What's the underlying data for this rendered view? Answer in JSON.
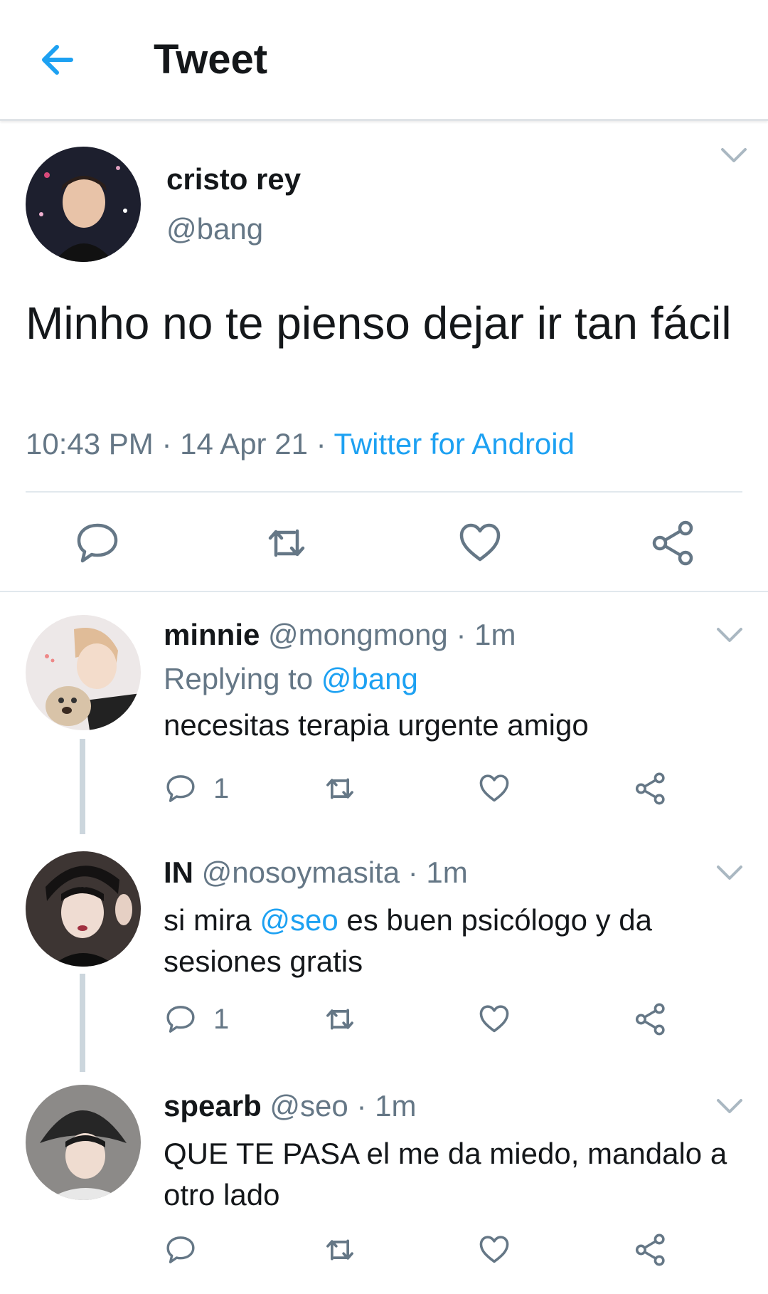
{
  "header": {
    "title": "Tweet"
  },
  "main_tweet": {
    "name": "cristo rey",
    "handle": "@bang",
    "text": "Minho no te pienso dejar ir tan fácil",
    "time": "10:43 PM",
    "sep1": " · ",
    "date": "14 Apr 21",
    "sep2": " · ",
    "source": "Twitter for Android"
  },
  "replies": [
    {
      "name": "minnie",
      "handle": "@mongmong",
      "time": "· 1m",
      "replying_prefix": "Replying to ",
      "replying_to": "@bang",
      "text": "necesitas terapia urgente amigo",
      "reply_count": "1"
    },
    {
      "name": "IN",
      "handle": "@nosoymasita",
      "time": "· 1m",
      "text_before": "si mira ",
      "mention": "@seo",
      "text_after": " es buen psicólogo y da sesiones gratis",
      "reply_count": "1"
    },
    {
      "name": "spearb",
      "handle": "@seo",
      "time": "· 1m",
      "text": "QUE TE PASA el me da miedo, mandalo a otro lado"
    }
  ],
  "icons": {
    "back": "arrow-left-icon",
    "caret": "chevron-down-icon",
    "reply": "speech-bubble-icon",
    "retweet": "retweet-icon",
    "like": "heart-icon",
    "share": "share-nodes-icon"
  },
  "colors": {
    "accent": "#1da1f2",
    "text_primary": "#14171a",
    "text_secondary": "#657786",
    "icon_gray": "#657786",
    "thread_line": "#ccd6dd"
  }
}
